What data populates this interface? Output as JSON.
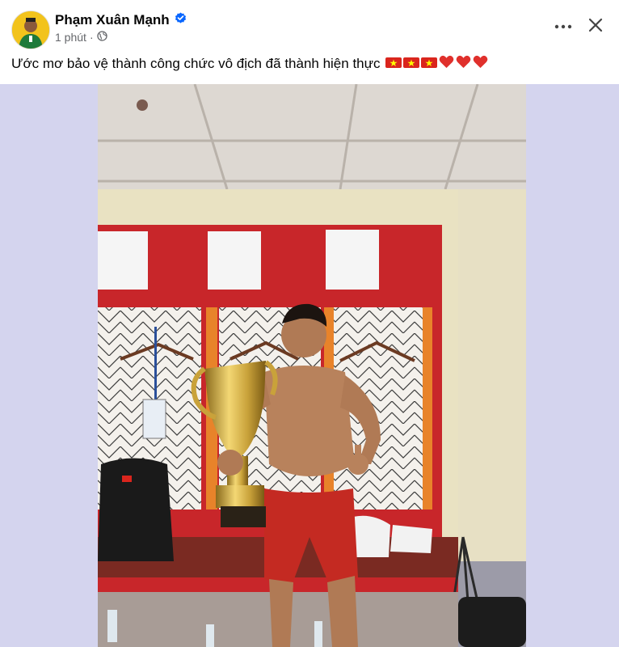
{
  "post": {
    "author_name": "Phạm Xuân Mạnh",
    "timestamp": "1 phút",
    "caption": "Ước mơ bảo vệ thành công chức vô địch đã thành hiện thực",
    "caption_emojis": [
      "vietnam-flag",
      "vietnam-flag",
      "vietnam-flag",
      "red-heart",
      "red-heart",
      "red-heart"
    ]
  },
  "icons": {
    "verified": "verified-badge-icon",
    "privacy": "globe-icon",
    "more": "more-horizontal-icon",
    "close": "close-icon"
  },
  "colors": {
    "verified_blue": "#0866ff",
    "photo_background": "#d4d4ee",
    "flag_red": "#da251d",
    "flag_star": "#ffff00",
    "heart_red": "#e0302c"
  }
}
